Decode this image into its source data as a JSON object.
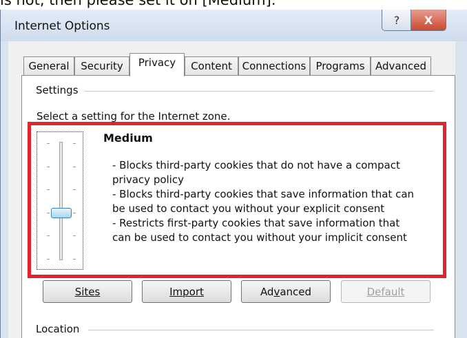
{
  "caption": "is not, then please set it on [Medium].",
  "window": {
    "title": "Internet Options",
    "help_glyph": "?",
    "close_glyph": "X"
  },
  "tabs": [
    {
      "label": "General",
      "active": false
    },
    {
      "label": "Security",
      "active": false
    },
    {
      "label": "Privacy",
      "active": true
    },
    {
      "label": "Content",
      "active": false
    },
    {
      "label": "Connections",
      "active": false
    },
    {
      "label": "Programs",
      "active": false
    },
    {
      "label": "Advanced",
      "active": false
    }
  ],
  "settings": {
    "group_label": "Settings",
    "zone_text": "Select a setting for the Internet zone.",
    "slider": {
      "levels": 6,
      "selected_level": 3
    },
    "level_name": "Medium",
    "description_lines": [
      "- Blocks third-party cookies that do not have a compact",
      "privacy policy",
      "- Blocks third-party cookies that save information that can",
      "be used to contact you without your explicit consent",
      "- Restricts first-party cookies that save information that",
      "can be used to contact you without your implicit consent"
    ]
  },
  "buttons": {
    "sites": "Sites",
    "import": "Import",
    "advanced": "Advanced",
    "default": "Default"
  },
  "location": {
    "group_label": "Location"
  },
  "colors": {
    "highlight_border": "#e5232b",
    "slider_thumb": "#a7d5f2"
  }
}
